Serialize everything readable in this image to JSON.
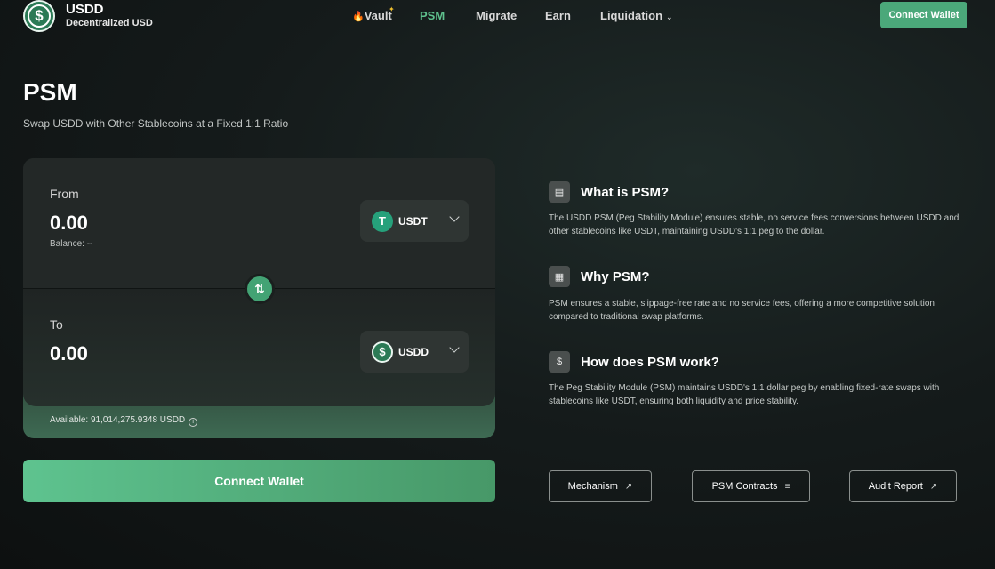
{
  "header": {
    "brand_name": "USDD",
    "brand_subtitle": "Decentralized USD",
    "nav": {
      "vault": "Vault",
      "psm": "PSM",
      "migrate": "Migrate",
      "earn": "Earn",
      "liquidation": "Liquidation"
    },
    "connect_wallet": "Connect Wallet"
  },
  "page": {
    "title": "PSM",
    "subtitle": "Swap USDD with Other Stablecoins at a Fixed 1:1 Ratio"
  },
  "swap": {
    "from_label": "From",
    "from_amount": "0.00",
    "balance": "Balance: --",
    "from_token": "USDT",
    "to_label": "To",
    "to_amount": "0.00",
    "to_token": "USDD",
    "available": "Available: 91,014,275.9348 USDD",
    "connect_wallet": "Connect Wallet"
  },
  "info": {
    "what_title": "What is PSM?",
    "what_text": "The USDD PSM (Peg Stability Module) ensures stable, no service fees conversions between USDD and other stablecoins like USDT, maintaining USDD's 1:1 peg to the dollar.",
    "why_title": "Why PSM?",
    "why_text": "PSM ensures a stable, slippage-free rate and no service fees, offering a more competitive solution compared to traditional swap platforms.",
    "how_title": "How does PSM work?",
    "how_text": "The Peg Stability Module (PSM) maintains USDD's 1:1 dollar peg by enabling fixed-rate swaps with stablecoins like USDT, ensuring both liquidity and price stability."
  },
  "links": {
    "mechanism": "Mechanism",
    "psm_contracts": "PSM Contracts",
    "audit_report": "Audit Report"
  },
  "colors": {
    "accent": "#5fc28e",
    "button": "#4ba87a",
    "tether": "#26a17b"
  },
  "icons": [
    "usdd-logo-icon",
    "flame-icon",
    "chevron-down-icon",
    "usdt-icon",
    "usdd-icon",
    "swap-arrows-icon",
    "info-icon",
    "chart-icon",
    "bank-icon",
    "dollar-cycle-icon",
    "external-link-icon",
    "list-icon"
  ]
}
